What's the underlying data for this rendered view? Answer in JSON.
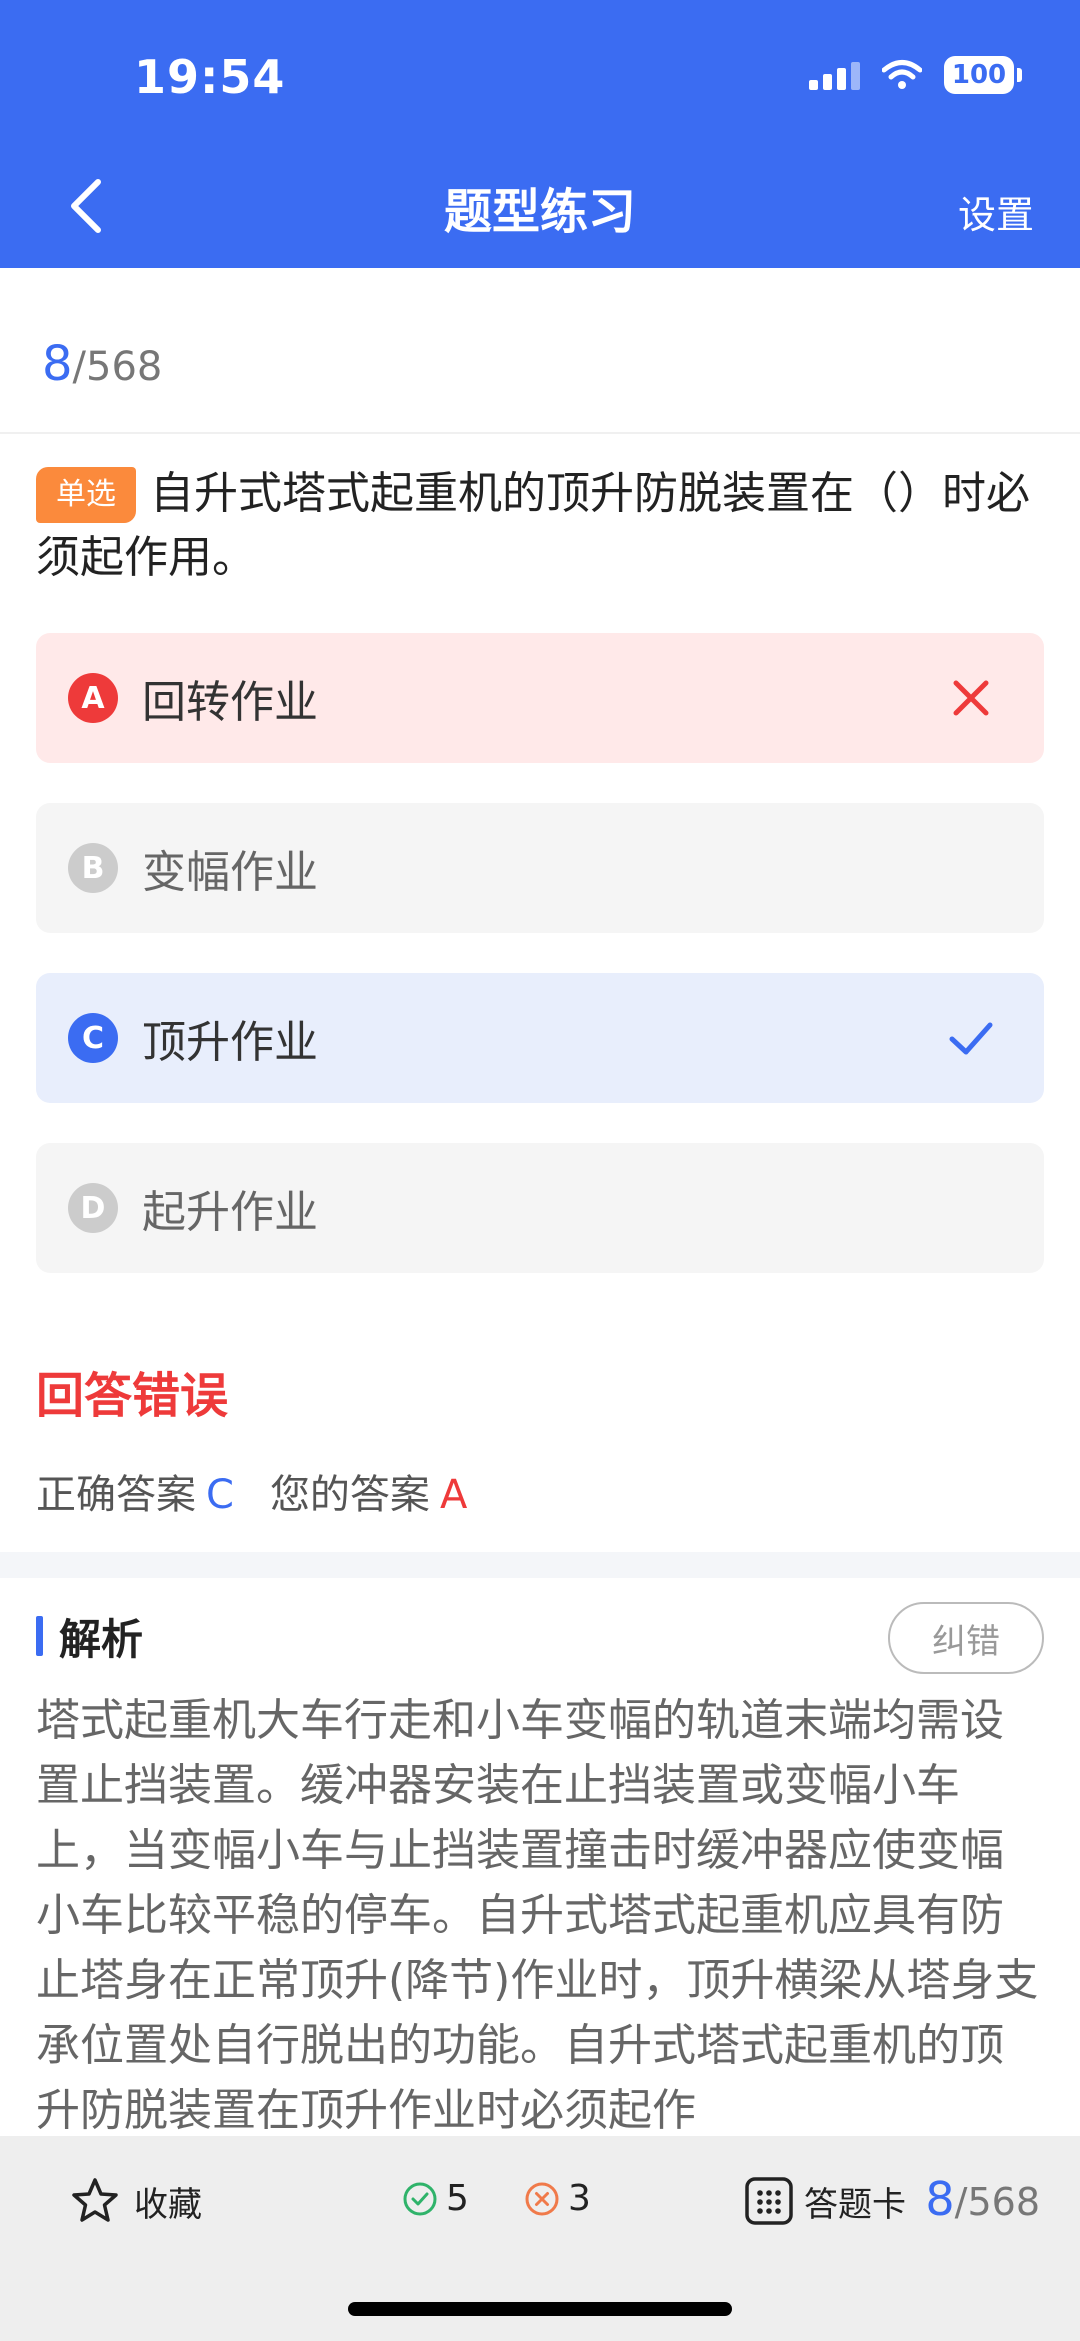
{
  "status_bar": {
    "time": "19:54",
    "battery": "100"
  },
  "nav": {
    "title": "题型练习",
    "settings_label": "设置"
  },
  "progress": {
    "current": "8",
    "total": "/568"
  },
  "question": {
    "type_badge": "单选",
    "text": "自升式塔式起重机的顶升防脱装置在（）时必须起作用。"
  },
  "options": [
    {
      "letter": "A",
      "text": "回转作业",
      "state": "wrong"
    },
    {
      "letter": "B",
      "text": "变幅作业",
      "state": "neutral"
    },
    {
      "letter": "C",
      "text": "顶升作业",
      "state": "correct"
    },
    {
      "letter": "D",
      "text": "起升作业",
      "state": "neutral"
    }
  ],
  "result": {
    "title": "回答错误",
    "correct_label": "正确答案",
    "correct_value": "C",
    "yours_label": "您的答案",
    "yours_value": "A"
  },
  "analysis": {
    "title": "解析",
    "report_label": "纠错",
    "text": "塔式起重机大车行走和小车变幅的轨道末端均需设置止挡装置。缓冲器安装在止挡装置或变幅小车上，当变幅小车与止挡装置撞击时缓冲器应使变幅小车比较平稳的停车。自升式塔式起重机应具有防止塔身在正常顶升(降节)作业时，顶升横梁从塔身支承位置处自行脱出的功能。自升式塔式起重机的顶升防脱装置在顶升作业时必须起作"
  },
  "bottom_bar": {
    "favorite_label": "收藏",
    "correct_count": "5",
    "wrong_count": "3",
    "card_label": "答题卡",
    "progress_current": "8",
    "progress_total": "/568"
  },
  "colors": {
    "accent": "#3b6cf2",
    "wrong": "#ee3a3a",
    "badge": "#fb8a3c"
  }
}
